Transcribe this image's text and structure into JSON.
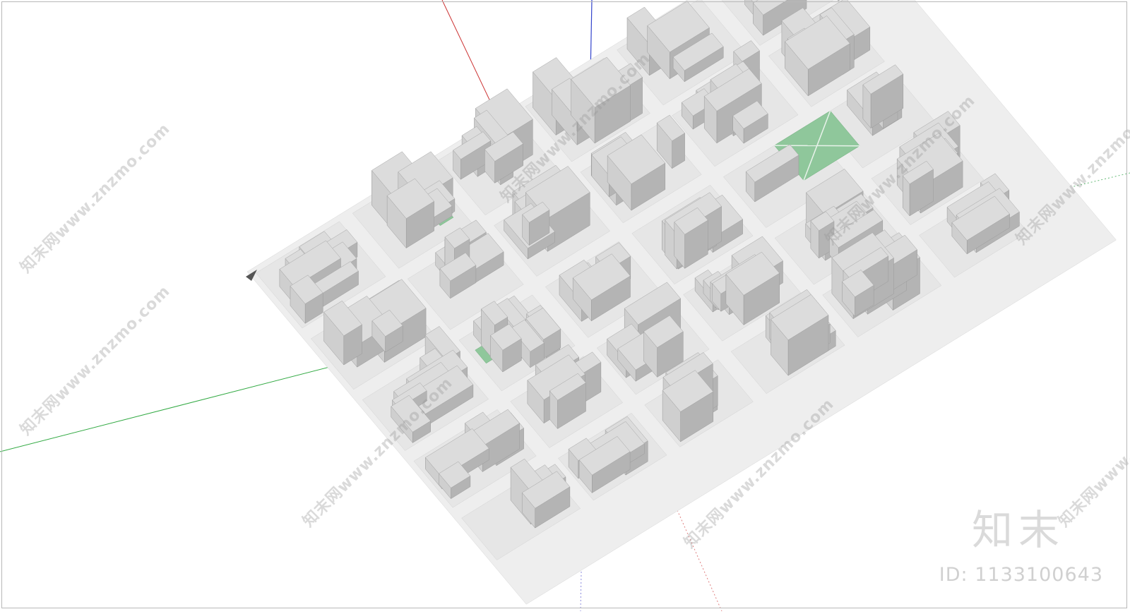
{
  "scene": {
    "background": "#ffffff",
    "building_color": "#c6c6c6",
    "ground_color": "#e6e6e6",
    "green_color": "#8fc79b",
    "axis_red": "#cc3333",
    "axis_green": "#33aa44",
    "axis_blue": "#3344cc"
  },
  "watermark": {
    "text": "知末网www.znzmo.com"
  },
  "logo": {
    "text": "知末"
  },
  "id_label": {
    "text": "ID: 1133100643"
  }
}
